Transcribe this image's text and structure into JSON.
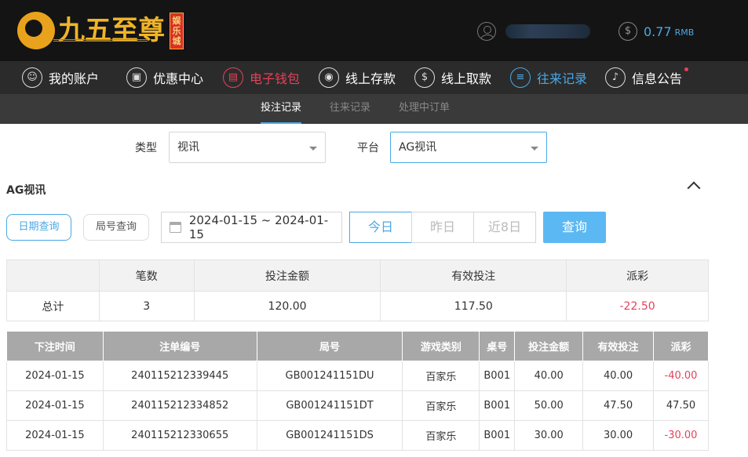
{
  "brand": {
    "name": "九五至尊",
    "badge": "娱乐城",
    "mark": "5"
  },
  "account": {
    "balance": "0.77",
    "currency": "RMB",
    "dollar_glyph": "$"
  },
  "nav": [
    {
      "label": "我的账户",
      "icon": "user-icon",
      "glyph": "☺"
    },
    {
      "label": "优惠中心",
      "icon": "gift-icon",
      "glyph": "▣"
    },
    {
      "label": "电子钱包",
      "icon": "wallet-icon",
      "glyph": "▤"
    },
    {
      "label": "线上存款",
      "icon": "deposit-icon",
      "glyph": "◉"
    },
    {
      "label": "线上取款",
      "icon": "withdraw-icon",
      "glyph": "$"
    },
    {
      "label": "往来记录",
      "icon": "records-icon",
      "glyph": "≡"
    },
    {
      "label": "信息公告",
      "icon": "bell-icon",
      "glyph": "♪"
    }
  ],
  "subtabs": [
    "投注记录",
    "往来记录",
    "处理中订单"
  ],
  "filters": {
    "type_label": "类型",
    "type_value": "视讯",
    "platform_label": "平台",
    "platform_value": "AG视讯"
  },
  "section_title": "AG视讯",
  "query": {
    "date_query": "日期查询",
    "round_query": "局号查询",
    "date_range": "2024-01-15 ~ 2024-01-15",
    "today": "今日",
    "yesterday": "昨日",
    "last8": "近8日",
    "search": "查询"
  },
  "summary": {
    "headers": [
      "",
      "笔数",
      "投注金额",
      "有效投注",
      "派彩"
    ],
    "row": {
      "label": "总计",
      "count": "3",
      "amount": "120.00",
      "valid": "117.50",
      "payout": "-22.50"
    }
  },
  "details": {
    "headers": [
      "下注时间",
      "注单编号",
      "局号",
      "游戏类别",
      "桌号",
      "投注金额",
      "有效投注",
      "派彩"
    ],
    "rows": [
      [
        "2024-01-15",
        "240115212339445",
        "GB001241151DU",
        "百家乐",
        "B001",
        "40.00",
        "40.00",
        "-40.00"
      ],
      [
        "2024-01-15",
        "240115212334852",
        "GB001241151DT",
        "百家乐",
        "B001",
        "50.00",
        "47.50",
        "47.50"
      ],
      [
        "2024-01-15",
        "240115212330655",
        "GB001241151DS",
        "百家乐",
        "B001",
        "30.00",
        "30.00",
        "-30.00"
      ]
    ]
  },
  "colors": {
    "accent": "#4aa8e6",
    "negative": "#e6415a",
    "gold": "#f0b428",
    "header_bg": "#141414"
  }
}
